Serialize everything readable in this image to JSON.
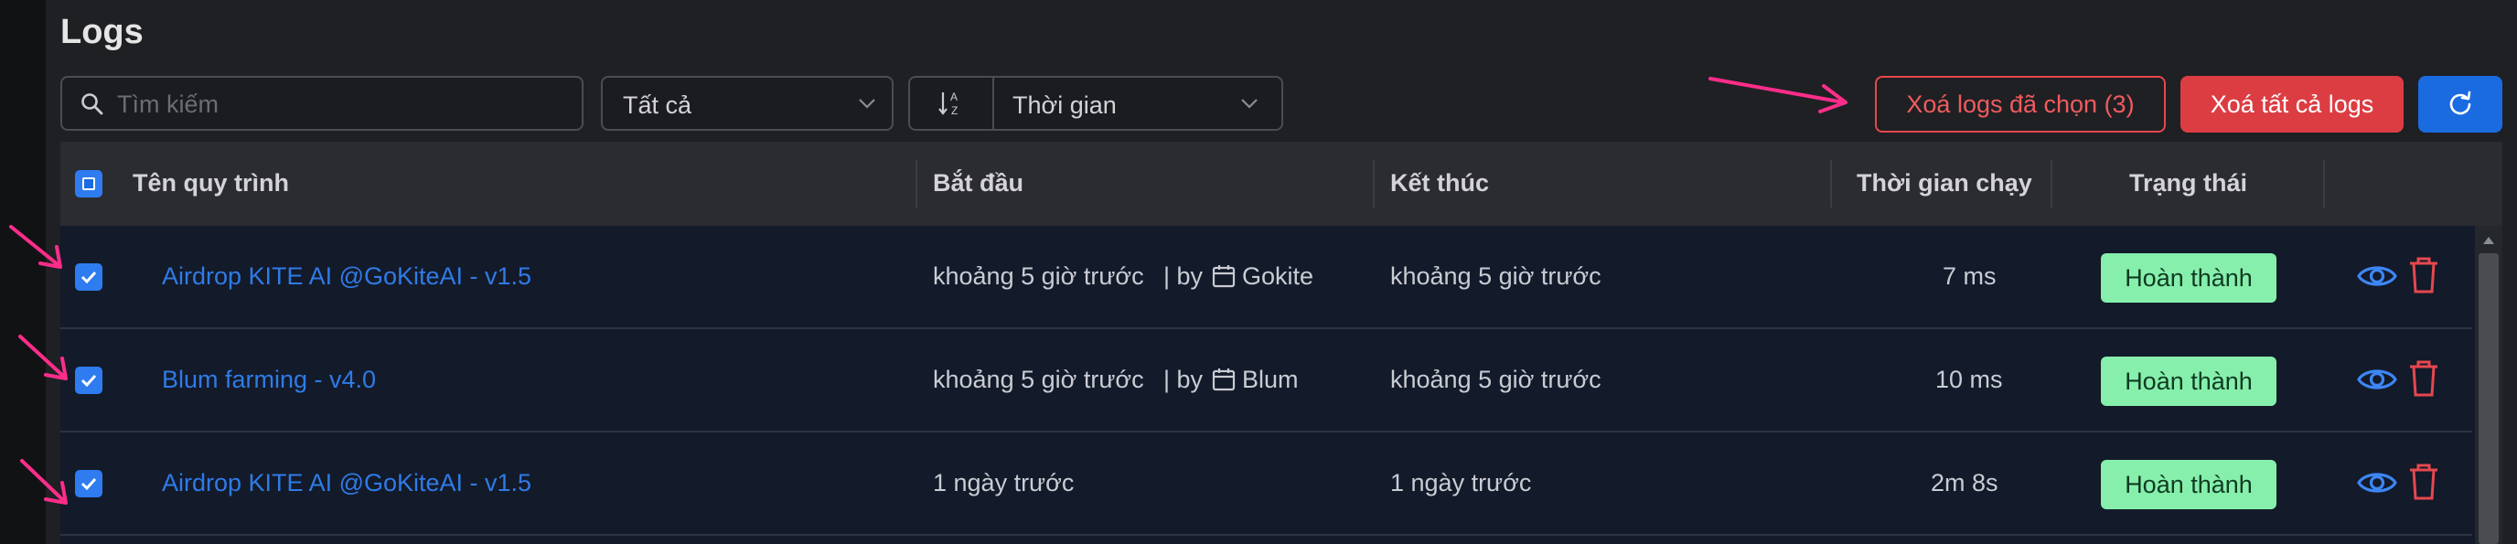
{
  "page": {
    "title": "Logs"
  },
  "toolbar": {
    "search_placeholder": "Tìm kiếm",
    "search_value": "",
    "filter_value": "Tất cả",
    "sort_field_value": "Thời gian",
    "delete_selected_label": "Xoá logs đã chọn (3)",
    "delete_all_label": "Xoá tất cả logs"
  },
  "table": {
    "columns": [
      "Tên quy trình",
      "Bắt đầu",
      "Kết thúc",
      "Thời gian chạy",
      "Trạng thái"
    ],
    "rows": [
      {
        "name": "Airdrop KITE AI @GoKiteAI - v1.5",
        "start": "khoảng 5 giờ trước",
        "by_label": "| by",
        "by_name": "Gokite",
        "end": "khoảng 5 giờ trước",
        "duration": "7 ms",
        "status": "Hoàn thành",
        "checked": true
      },
      {
        "name": "Blum farming - v4.0",
        "start": "khoảng 5 giờ trước",
        "by_label": "| by",
        "by_name": "Blum",
        "end": "khoảng 5 giờ trước",
        "duration": "10 ms",
        "status": "Hoàn thành",
        "checked": true
      },
      {
        "name": "Airdrop KITE AI @GoKiteAI - v1.5",
        "start": "1 ngày trước",
        "end": "1 ngày trước",
        "duration": "2m 8s",
        "status": "Hoàn thành",
        "checked": true
      }
    ]
  },
  "icons": {
    "search": "search-icon",
    "chevron": "chevron-down-icon",
    "sort": "sort-az-icon",
    "refresh": "refresh-icon",
    "calendar": "calendar-icon",
    "view": "eye-icon",
    "delete": "trash-icon",
    "annotation": "arrow-annotation-icon"
  },
  "colors": {
    "accent_blue": "#2f7cf0",
    "danger_red": "#dc3d43",
    "success_green": "#86efac",
    "annotation_pink": "#ff2d8a"
  }
}
